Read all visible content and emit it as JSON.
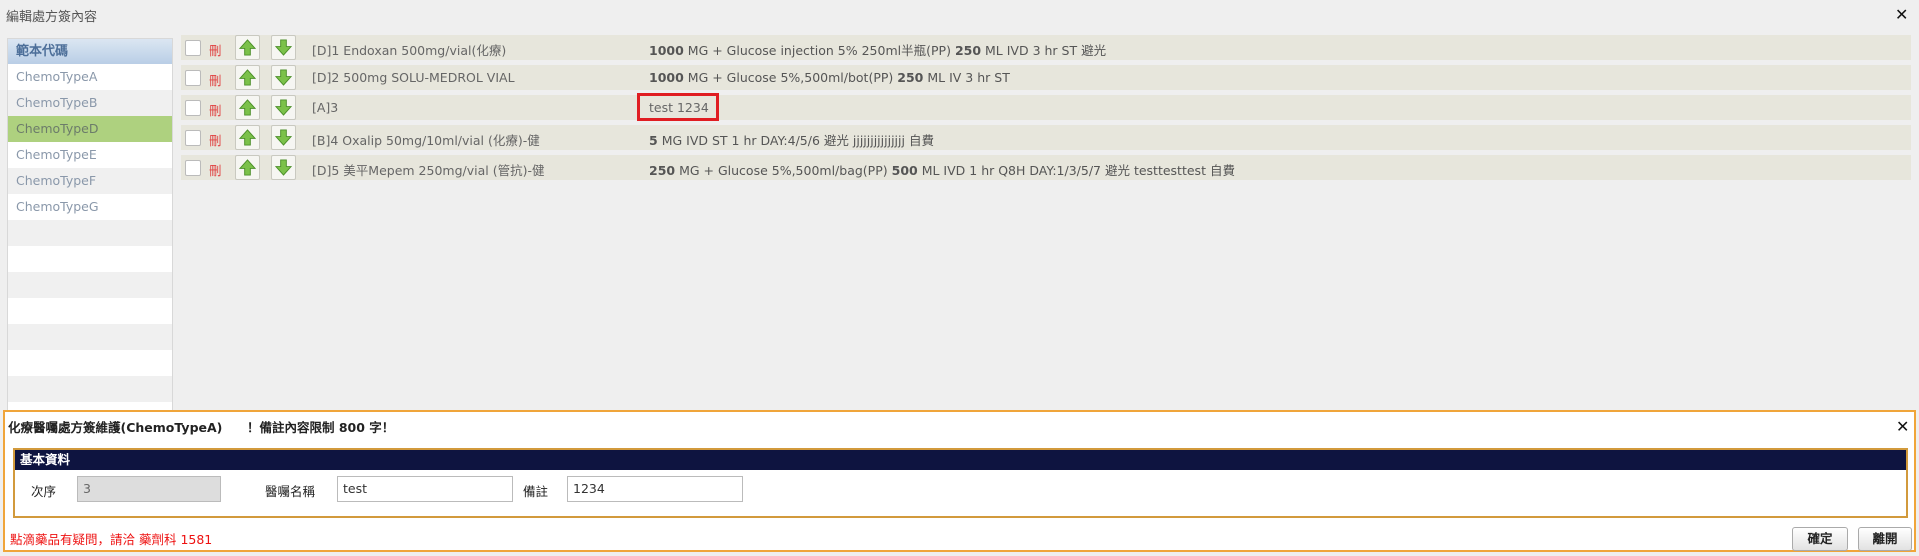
{
  "window": {
    "title": "編輯處方簽內容"
  },
  "template_list": {
    "header": "範本代碼",
    "items": [
      "ChemoTypeA",
      "ChemoTypeB",
      "ChemoTypeD",
      "ChemoTypeE",
      "ChemoTypeF",
      "ChemoTypeG"
    ],
    "selected": "ChemoTypeD"
  },
  "orders": [
    {
      "delete_label": "刪",
      "drug": "[D]1 Endoxan 500mg/vial(化療)",
      "dose_num": "1000",
      "dose_mid": "MG  + Glucose injection 5% 250ml半瓶(PP)",
      "dose_num2": "250",
      "dose_rest": "ML IVD 3 hr ST 避光"
    },
    {
      "delete_label": "刪",
      "drug": "[D]2 500mg SOLU-MEDROL VIAL",
      "dose_num": "1000",
      "dose_mid": "MG  + Glucose 5%,500ml/bot(PP)",
      "dose_num2": "250",
      "dose_rest": "ML IV 3 hr ST"
    },
    {
      "delete_label": "刪",
      "drug": "[A]3",
      "note": "test 1234"
    },
    {
      "delete_label": "刪",
      "drug": "[B]4 Oxalip 50mg/10ml/vial (化療)-健",
      "dose_num": "5",
      "dose_mid": "MG IVD ST 1 hr DAY:4/5/6 避光 jjjjjjjjjjjjjjj 自費",
      "dose_num2": "",
      "dose_rest": ""
    },
    {
      "delete_label": "刪",
      "drug": "[D]5 美平Mepem 250mg/vial (管抗)-健",
      "dose_num": "250",
      "dose_mid": "MG  + Glucose 5%,500ml/bag(PP)",
      "dose_num2": "500",
      "dose_rest": "ML IVD 1 hr Q8H DAY:1/3/5/7 避光 testtesttest 自費"
    }
  ],
  "editor": {
    "title": "化療醫囑處方簽維護(ChemoTypeA)",
    "limit_note": "！備註內容限制 800 字！",
    "section_title": "基本資料",
    "seq_label": "次序",
    "seq_value": "3",
    "name_label": "醫囑名稱",
    "name_value": "test",
    "remark_label": "備註",
    "remark_value": "1234"
  },
  "footer": {
    "message": "點滴藥品有疑問，請洽 藥劑科 1581",
    "confirm_label": "確定",
    "leave_label": "離開"
  },
  "colors": {
    "selected_row": "#aed17f",
    "highlight": "#e01d22",
    "dialog_border": "#f0a53a",
    "section_bar": "#0e1440"
  }
}
